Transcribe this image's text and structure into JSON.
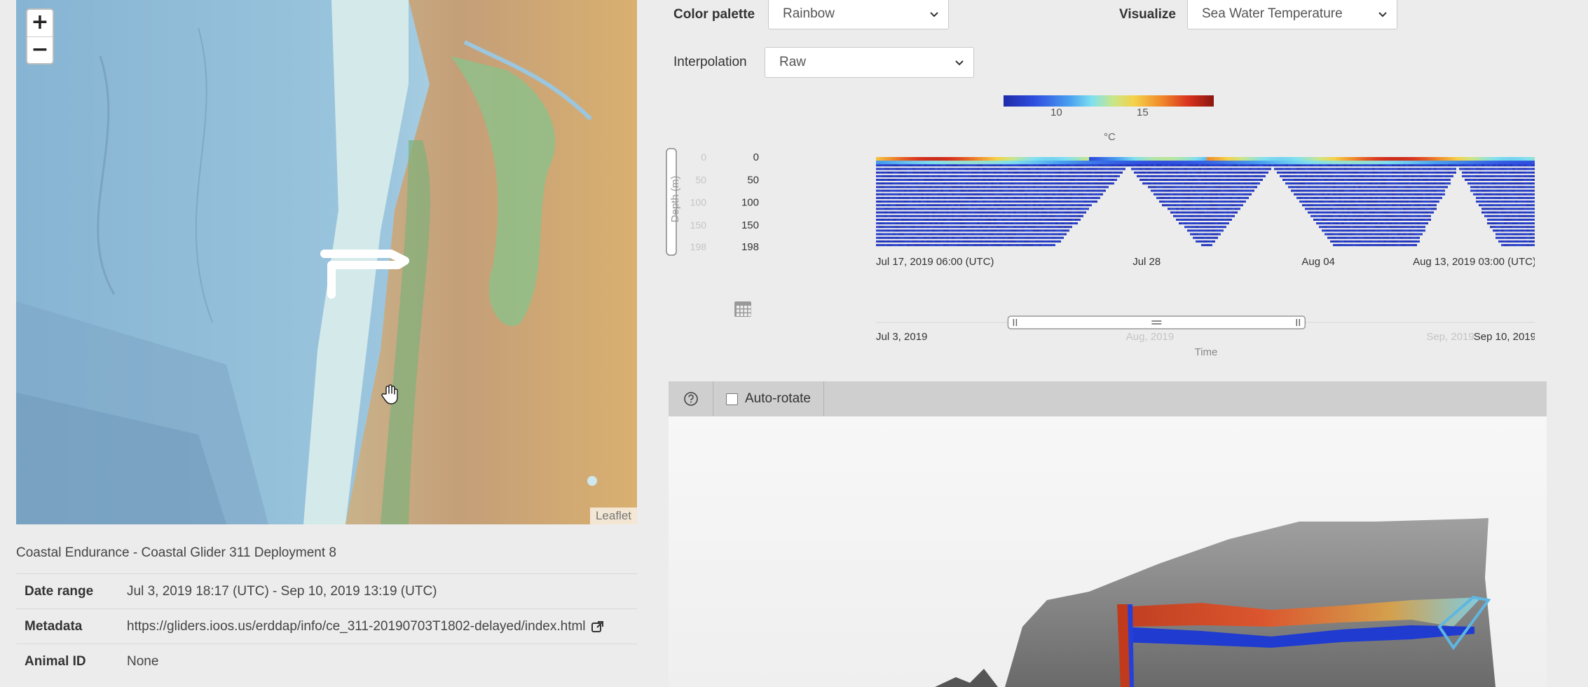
{
  "map": {
    "zoom_in": "+",
    "zoom_out": "−",
    "attribution": "Leaflet"
  },
  "dataset": {
    "title": "Coastal Endurance - Coastal Glider 311 Deployment 8",
    "rows": [
      {
        "label": "Date range",
        "value": "Jul 3, 2019 18:17 (UTC) - Sep 10, 2019 13:19 (UTC)"
      },
      {
        "label": "Metadata",
        "value": "https://gliders.ioos.us/erddap/info/ce_311-20190703T1802-delayed/index.html"
      },
      {
        "label": "Animal ID",
        "value": "None"
      }
    ]
  },
  "controls": {
    "color_palette_label": "Color palette",
    "color_palette_value": "Rainbow",
    "visualize_label": "Visualize",
    "visualize_value": "Sea Water Temperature",
    "interpolation_label": "Interpolation",
    "interpolation_value": "Raw"
  },
  "colorbar": {
    "ticks": [
      "10",
      "15"
    ],
    "unit": "°C"
  },
  "chart_data": {
    "type": "heatmap",
    "ylabel": "Depth (m)",
    "xlabel": "Time",
    "y_ticks": [
      "0",
      "50",
      "100",
      "150",
      "198"
    ],
    "y_range": [
      0,
      198
    ],
    "x_ticks": [
      "Jul 17, 2019 06:00 (UTC)",
      "Jul 28",
      "Aug 04",
      "Aug 13, 2019 03:00 (UTC)"
    ],
    "range_slider": {
      "ticks": [
        "Jul 3, 2019",
        "Aug, 2019",
        "Sep, 2019",
        "Sep 10, 2019"
      ],
      "selected_fraction": [
        0.2,
        0.65
      ]
    },
    "value_range": [
      8,
      18
    ]
  },
  "toolbar": {
    "auto_rotate_label": "Auto-rotate",
    "auto_rotate_checked": false
  }
}
